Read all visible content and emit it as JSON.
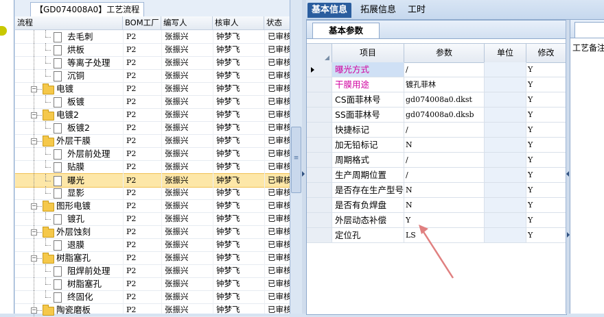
{
  "tree_panel": {
    "tab_title": "【GD074008A0】工艺流程",
    "headers": [
      "流程",
      "BOM工厂",
      "编写人",
      "核审人",
      "状态"
    ],
    "rows": [
      {
        "name": "去毛刺",
        "type": "leaf",
        "bom": "P2",
        "writer": "张振兴",
        "reviewer": "钟梦飞",
        "status": "已审核"
      },
      {
        "name": "烘板",
        "type": "leaf",
        "bom": "P2",
        "writer": "张振兴",
        "reviewer": "钟梦飞",
        "status": "已审核"
      },
      {
        "name": "等离子处理",
        "type": "leaf",
        "bom": "P2",
        "writer": "张振兴",
        "reviewer": "钟梦飞",
        "status": "已审核"
      },
      {
        "name": "沉铜",
        "type": "leaf",
        "bom": "P2",
        "writer": "张振兴",
        "reviewer": "钟梦飞",
        "status": "已审核"
      },
      {
        "name": "电镀",
        "type": "group",
        "bom": "P2",
        "writer": "张振兴",
        "reviewer": "钟梦飞",
        "status": "已审核"
      },
      {
        "name": "板镀",
        "type": "leaf",
        "bom": "P2",
        "writer": "张振兴",
        "reviewer": "钟梦飞",
        "status": "已审核"
      },
      {
        "name": "电镀2",
        "type": "group",
        "bom": "P2",
        "writer": "张振兴",
        "reviewer": "钟梦飞",
        "status": "已审核"
      },
      {
        "name": "板镀2",
        "type": "leaf",
        "bom": "P2",
        "writer": "张振兴",
        "reviewer": "钟梦飞",
        "status": "已审核"
      },
      {
        "name": "外层干膜",
        "type": "group",
        "bom": "P2",
        "writer": "张振兴",
        "reviewer": "钟梦飞",
        "status": "已审核"
      },
      {
        "name": "外层前处理",
        "type": "leaf",
        "bom": "P2",
        "writer": "张振兴",
        "reviewer": "钟梦飞",
        "status": "已审核"
      },
      {
        "name": "贴膜",
        "type": "leaf",
        "bom": "P2",
        "writer": "张振兴",
        "reviewer": "钟梦飞",
        "status": "已审核"
      },
      {
        "name": "曝光",
        "type": "leaf",
        "selected": true,
        "bom": "P2",
        "writer": "张振兴",
        "reviewer": "钟梦飞",
        "status": "已审核"
      },
      {
        "name": "显影",
        "type": "leaf",
        "bom": "P2",
        "writer": "张振兴",
        "reviewer": "钟梦飞",
        "status": "已审核"
      },
      {
        "name": "图形电镀",
        "type": "group",
        "bom": "P2",
        "writer": "张振兴",
        "reviewer": "钟梦飞",
        "status": "已审核"
      },
      {
        "name": "镀孔",
        "type": "leaf",
        "bom": "P2",
        "writer": "张振兴",
        "reviewer": "钟梦飞",
        "status": "已审核"
      },
      {
        "name": "外层蚀刻",
        "type": "group",
        "bom": "P2",
        "writer": "张振兴",
        "reviewer": "钟梦飞",
        "status": "已审核"
      },
      {
        "name": "退膜",
        "type": "leaf",
        "bom": "P2",
        "writer": "张振兴",
        "reviewer": "钟梦飞",
        "status": "已审核"
      },
      {
        "name": "树脂塞孔",
        "type": "group",
        "bom": "P2",
        "writer": "张振兴",
        "reviewer": "钟梦飞",
        "status": "已审核"
      },
      {
        "name": "阻焊前处理",
        "type": "leaf",
        "bom": "P2",
        "writer": "张振兴",
        "reviewer": "钟梦飞",
        "status": "已审核"
      },
      {
        "name": "树脂塞孔",
        "type": "leaf",
        "bom": "P2",
        "writer": "张振兴",
        "reviewer": "钟梦飞",
        "status": "已审核"
      },
      {
        "name": "终固化",
        "type": "leaf",
        "bom": "P2",
        "writer": "张振兴",
        "reviewer": "钟梦飞",
        "status": "已审核"
      },
      {
        "name": "陶瓷磨板",
        "type": "group",
        "bom": "P2",
        "writer": "张振兴",
        "reviewer": "钟梦飞",
        "status": "已审核"
      }
    ]
  },
  "main_tabs": [
    "基本信息",
    "拓展信息",
    "工时"
  ],
  "params_panel": {
    "sub_tab": "基本参数",
    "headers": [
      "项目",
      "参数",
      "单位",
      "修改"
    ],
    "rows": [
      {
        "item": "曝光方式",
        "value": "/",
        "unit": "",
        "modify": "Y",
        "pink": true,
        "current": true
      },
      {
        "item": "干膜用途",
        "value": "镀孔菲林",
        "unit": "",
        "modify": "Y",
        "pink": true
      },
      {
        "item": "CS面菲林号",
        "value": "gd074008a0.dkst",
        "unit": "",
        "modify": "Y"
      },
      {
        "item": "SS面菲林号",
        "value": "gd074008a0.dksb",
        "unit": "",
        "modify": "Y"
      },
      {
        "item": "快捷标记",
        "value": "/",
        "unit": "",
        "modify": "Y"
      },
      {
        "item": "加无铅标记",
        "value": "N",
        "unit": "",
        "modify": "Y"
      },
      {
        "item": "周期格式",
        "value": "/",
        "unit": "",
        "modify": "Y"
      },
      {
        "item": "生产周期位置",
        "value": "/",
        "unit": "",
        "modify": "Y"
      },
      {
        "item": "是否存在生产型号",
        "value": "N",
        "unit": "",
        "modify": "Y"
      },
      {
        "item": "是否有负焊盘",
        "value": "N",
        "unit": "",
        "modify": "Y"
      },
      {
        "item": "外层动态补偿",
        "value": "Y",
        "unit": "",
        "modify": "Y"
      },
      {
        "item": "定位孔",
        "value": "LS",
        "unit": "",
        "modify": "Y"
      }
    ]
  },
  "extra_panel": {
    "label": "工艺备注"
  },
  "colors": {
    "accent_tab": "#2a5d9e",
    "pink_text": "#d000a0",
    "arrow": "#e08080",
    "selected_row": "#fde7a8"
  }
}
